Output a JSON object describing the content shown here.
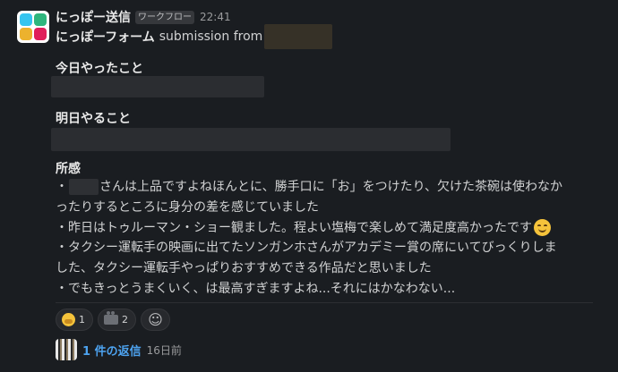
{
  "message": {
    "sender": "にっぽー送信",
    "badge": "ワークフロー",
    "time": "22:41",
    "form_name": "にっぽーフォーム",
    "submission_text": "submission from"
  },
  "sections": {
    "today_title": "今日やったこと",
    "tomorrow_title": "明日やること",
    "thoughts_title": "所感"
  },
  "body": {
    "line1_prefix": "・",
    "line1_rest": "さんは上品ですよねほんとに、勝手口に「お」をつけたり、欠けた茶碗は使わなか",
    "line2": "ったりするところに身分の差を感じていました",
    "line3": "・昨日はトゥルーマン・ショー観ました。程よい塩梅で楽しめて満足度高かったです",
    "line4": "・タクシー運転手の映画に出てたソンガンホさんがアカデミー賞の席にいてびっくりしま",
    "line5": "した、タクシー運転手やっぱりおすすめできる作品だと思いました",
    "line6": "・でもきっとうまくいく、は最高すぎますよね...それにはかなわない..."
  },
  "reactions": [
    {
      "icon": "hushed-face-icon",
      "count": "1"
    },
    {
      "icon": "movie-camera-icon",
      "count": "2"
    }
  ],
  "thread": {
    "reply_link": "1 件の返信",
    "reply_time": "16日前"
  }
}
